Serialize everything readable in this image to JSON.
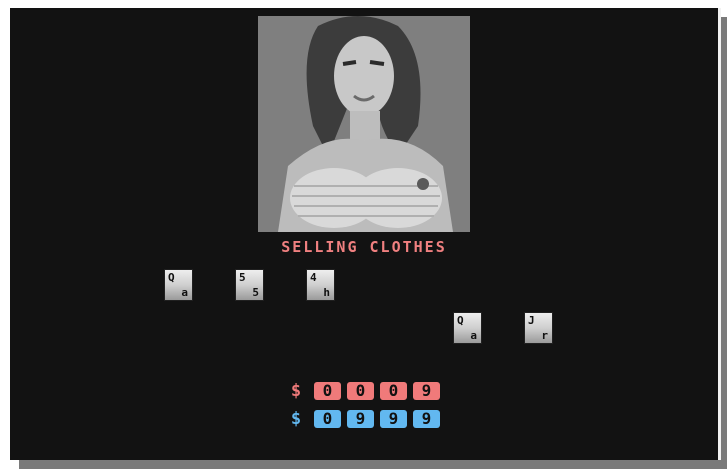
{
  "title": "Selling Clothes",
  "colors": {
    "title": "#f08080",
    "money_pink": "#f07a7a",
    "money_blue": "#62b8f0",
    "screen_bg": "#121212"
  },
  "portrait": {
    "icon": "portrait-image"
  },
  "player_hand": [
    {
      "top": "Q",
      "bottom": "a"
    },
    {
      "top": "5",
      "bottom": "5"
    },
    {
      "top": "4",
      "bottom": "h"
    }
  ],
  "opponent_hand": [
    {
      "top": "Q",
      "bottom": "a"
    },
    {
      "top": "J",
      "bottom": "r"
    }
  ],
  "money": {
    "pink": {
      "symbol": "$",
      "digits": [
        "0",
        "0",
        "0",
        "9"
      ]
    },
    "blue": {
      "symbol": "$",
      "digits": [
        "0",
        "9",
        "9",
        "9"
      ]
    }
  }
}
